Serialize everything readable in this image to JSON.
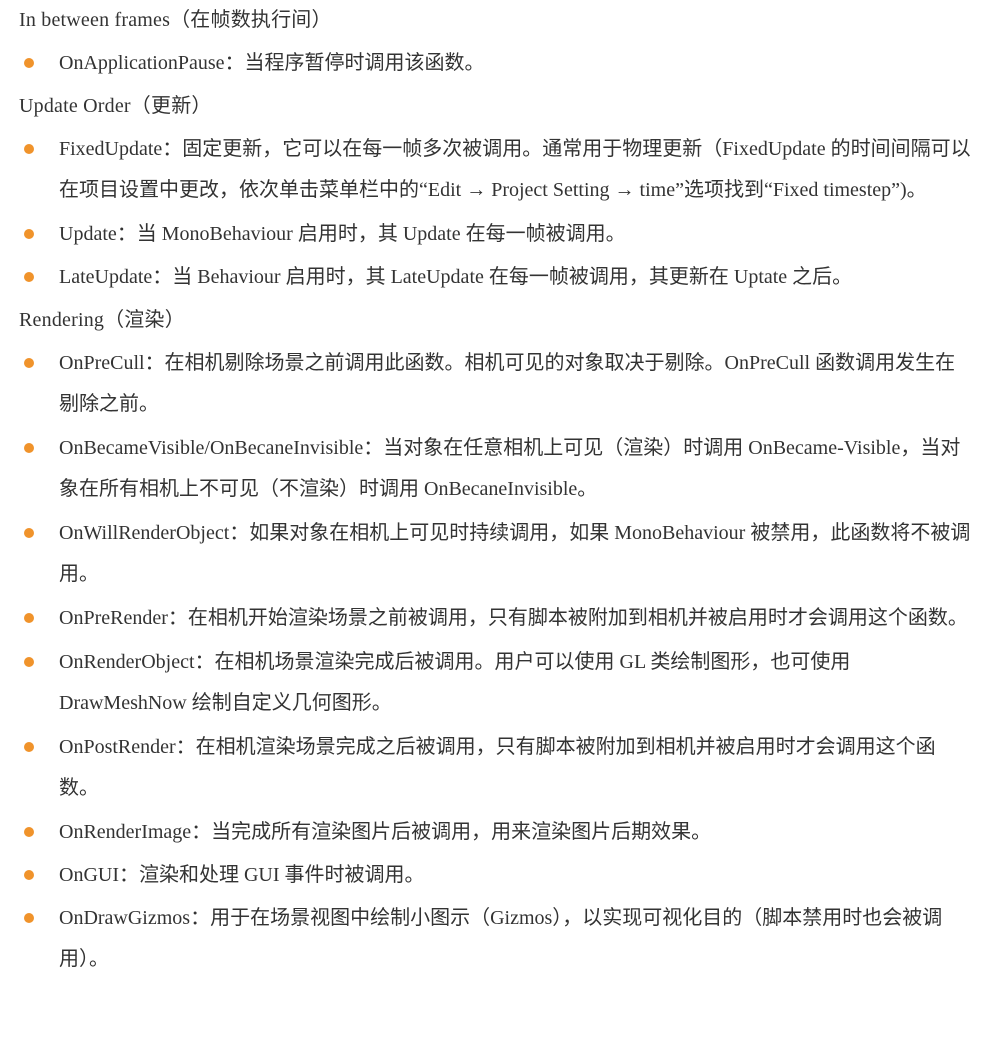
{
  "sections": [
    {
      "heading": "In between frames（在帧数执行间）",
      "items": [
        {
          "text": "OnApplicationPause：当程序暂停时调用该函数。"
        }
      ]
    },
    {
      "heading": "Update Order（更新）",
      "items": [
        {
          "text": "FixedUpdate：固定更新，它可以在每一帧多次被调用。通常用于物理更新（FixedUpdate 的时间间隔可以在项目设置中更改，依次单击菜单栏中的“Edit → Project Setting → time”选项找到“Fixed timestep”)。"
        },
        {
          "text": "Update：当 MonoBehaviour 启用时，其 Update 在每一帧被调用。"
        },
        {
          "text": "LateUpdate：当 Behaviour 启用时，其 LateUpdate 在每一帧被调用，其更新在 Uptate 之后。"
        }
      ]
    },
    {
      "heading": "Rendering（渲染）",
      "items": [
        {
          "text": "OnPreCull：在相机剔除场景之前调用此函数。相机可见的对象取决于剔除。OnPreCull 函数调用发生在剔除之前。"
        },
        {
          "text": "OnBecameVisible/OnBecaneInvisible：当对象在任意相机上可见（渲染）时调用 OnBecame-Visible，当对象在所有相机上不可见（不渲染）时调用 OnBecaneInvisible。"
        },
        {
          "text": "OnWillRenderObject：如果对象在相机上可见时持续调用，如果 MonoBehaviour 被禁用，此函数将不被调用。"
        },
        {
          "text": "OnPreRender：在相机开始渲染场景之前被调用，只有脚本被附加到相机并被启用时才会调用这个函数。"
        },
        {
          "text": "OnRenderObject：在相机场景渲染完成后被调用。用户可以使用 GL 类绘制图形，也可使用 DrawMeshNow 绘制自定义几何图形。"
        },
        {
          "text": "OnPostRender：在相机渲染场景完成之后被调用，只有脚本被附加到相机并被启用时才会调用这个函数。"
        },
        {
          "text": "OnRenderImage：当完成所有渲染图片后被调用，用来渲染图片后期效果。"
        },
        {
          "text": "OnGUI：渲染和处理 GUI 事件时被调用。"
        },
        {
          "text": "OnDrawGizmos：用于在场景视图中绘制小图示（Gizmos），以实现可视化目的（脚本禁用时也会被调用）。"
        }
      ]
    }
  ],
  "colors": {
    "bullet": "#f0932b",
    "text": "#333333"
  }
}
